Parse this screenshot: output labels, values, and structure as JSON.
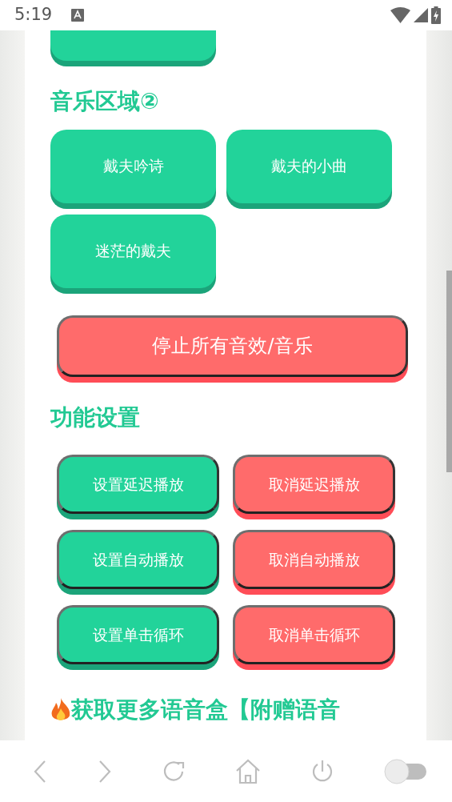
{
  "status_bar": {
    "time": "5:19"
  },
  "music_section": {
    "title": "音乐区域②",
    "buttons": [
      {
        "label": "戴夫吟诗"
      },
      {
        "label": "戴夫的小曲"
      },
      {
        "label": "迷茫的戴夫"
      }
    ]
  },
  "stop_button": {
    "label": "停止所有音效/音乐"
  },
  "settings_section": {
    "title": "功能设置",
    "buttons": [
      {
        "label": "设置延迟播放",
        "kind": "set"
      },
      {
        "label": "取消延迟播放",
        "kind": "cancel"
      },
      {
        "label": "设置自动播放",
        "kind": "set"
      },
      {
        "label": "取消自动播放",
        "kind": "cancel"
      },
      {
        "label": "设置单击循环",
        "kind": "set"
      },
      {
        "label": "取消单击循环",
        "kind": "cancel"
      }
    ]
  },
  "promo_heading": {
    "text": "获取更多语音盒【附赠语音"
  },
  "nav_bar": {
    "toggle": {
      "on": false
    }
  }
}
